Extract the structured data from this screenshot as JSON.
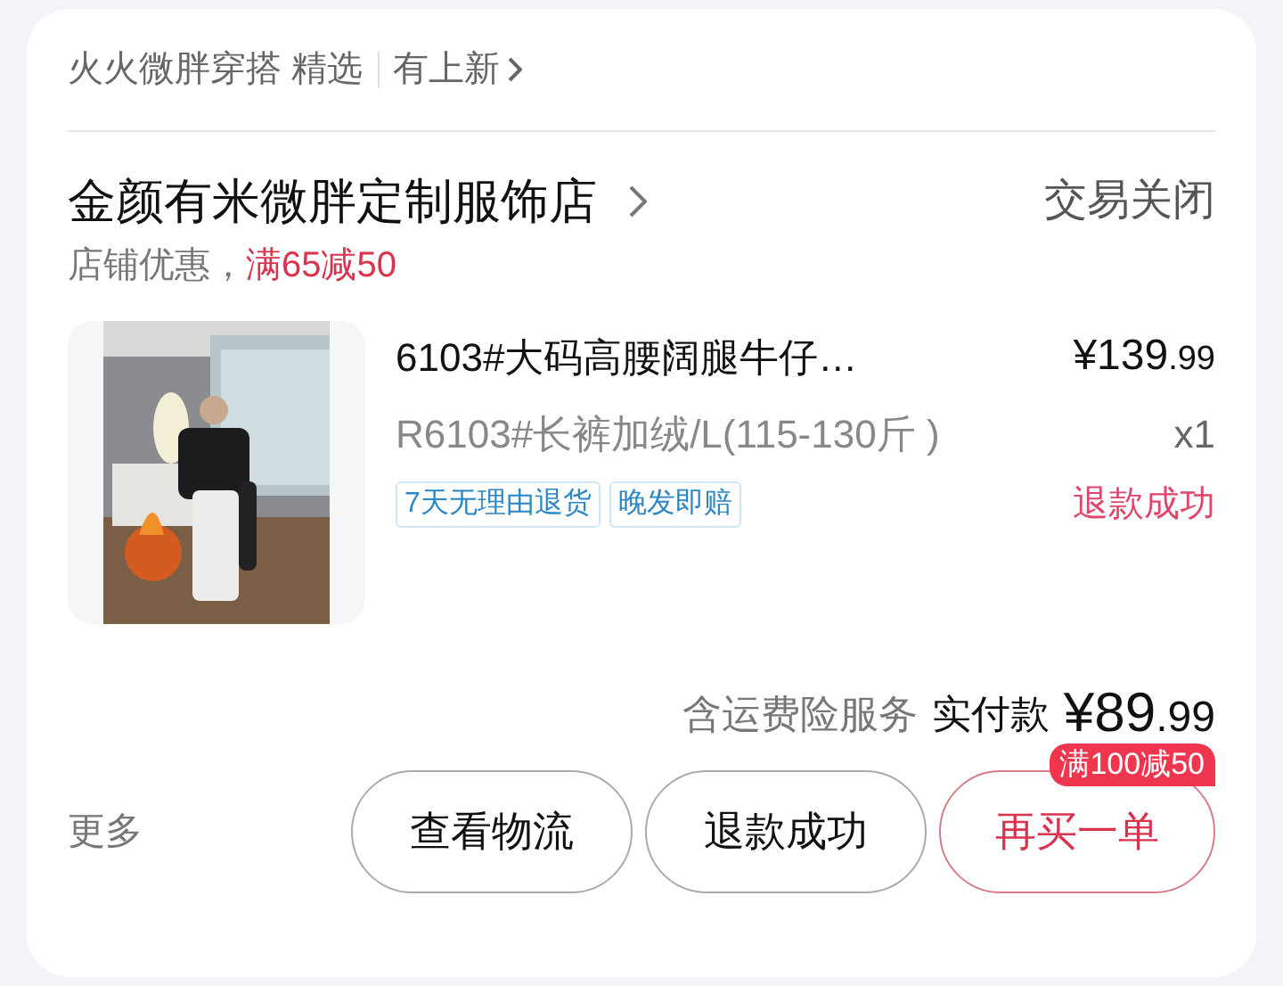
{
  "header": {
    "source": "火火微胖穿搭 精选",
    "link": "有上新"
  },
  "shop": {
    "name": "金颜有米微胖定制服饰店",
    "status": "交易关闭",
    "promo_label": "店铺优惠，",
    "promo_value": "满65减50"
  },
  "item": {
    "title": "6103#大码高腰阔腿牛仔…",
    "price": {
      "integer": "¥139",
      "decimal": ".99"
    },
    "variant": "R6103#长裤加绒/L(115-130斤 )",
    "quantity": "x1",
    "tags": [
      "7天无理由退货",
      "晚发即赔"
    ],
    "item_status": "退款成功"
  },
  "total": {
    "note": "含运费险服务",
    "label": "实付款",
    "amount": {
      "integer": "¥89",
      "decimal": ".99"
    }
  },
  "more": "更多",
  "buttons": [
    {
      "label": "查看物流",
      "kind": "plain"
    },
    {
      "label": "退款成功",
      "kind": "plain"
    },
    {
      "label": "再买一单",
      "kind": "primary",
      "badge": "满100减50"
    }
  ]
}
